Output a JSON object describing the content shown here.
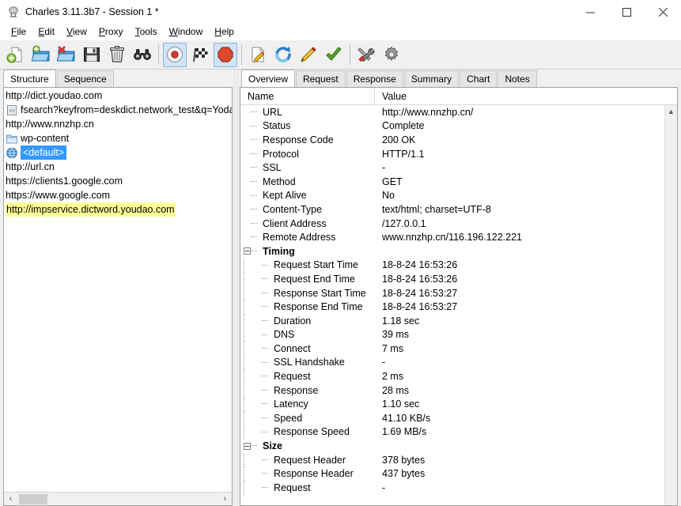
{
  "window": {
    "title": "Charles 3.11.3b7 - Session 1 *",
    "app_icon": "charles-glass-icon",
    "controls": [
      {
        "name": "minimize",
        "glyph": "—"
      },
      {
        "name": "maximize",
        "glyph": "☐"
      },
      {
        "name": "close",
        "glyph": "✕"
      }
    ]
  },
  "menubar": {
    "items": [
      {
        "mnemonic": "F",
        "rest": "ile"
      },
      {
        "mnemonic": "E",
        "rest": "dit"
      },
      {
        "mnemonic": "V",
        "rest": "iew"
      },
      {
        "mnemonic": "P",
        "rest": "roxy"
      },
      {
        "mnemonic": "T",
        "rest": "ools"
      },
      {
        "mnemonic": "W",
        "rest": "indow"
      },
      {
        "mnemonic": "H",
        "rest": "elp"
      }
    ]
  },
  "toolbar": {
    "buttons": [
      {
        "name": "new-session-icon",
        "active": false
      },
      {
        "name": "open-session-icon",
        "active": false
      },
      {
        "name": "close-session-icon",
        "active": false
      },
      {
        "name": "save-session-icon",
        "active": false
      },
      {
        "name": "clear-session-icon",
        "active": false
      },
      {
        "name": "find-icon",
        "active": false
      },
      {
        "name": "record-icon",
        "active": true
      },
      {
        "name": "throttle-icon",
        "active": false
      },
      {
        "name": "breakpoints-icon",
        "active": true
      },
      {
        "name": "compose-icon",
        "active": false
      },
      {
        "name": "repeat-icon",
        "active": false
      },
      {
        "name": "edit-icon",
        "active": false
      },
      {
        "name": "validate-icon",
        "active": false
      },
      {
        "name": "tools-icon",
        "active": false
      },
      {
        "name": "settings-icon",
        "active": false
      }
    ]
  },
  "left_panel": {
    "tabs": [
      {
        "label": "Structure",
        "active": true
      },
      {
        "label": "Sequence",
        "active": false
      }
    ],
    "tree": [
      {
        "label": "http://dict.youdao.com",
        "icon": "none",
        "indent": 0,
        "state": "normal"
      },
      {
        "label": "fsearch?keyfrom=deskdict.network_test&q=Yodao'",
        "icon": "file-icon",
        "indent": 1,
        "state": "normal"
      },
      {
        "label": "http://www.nnzhp.cn",
        "icon": "none",
        "indent": 0,
        "state": "normal"
      },
      {
        "label": "wp-content",
        "icon": "folder-icon",
        "indent": 1,
        "state": "normal"
      },
      {
        "label": "<default>",
        "icon": "globe-icon",
        "indent": 1,
        "state": "selected"
      },
      {
        "label": "http://url.cn",
        "icon": "none",
        "indent": 0,
        "state": "normal"
      },
      {
        "label": "https://clients1.google.com",
        "icon": "none",
        "indent": 0,
        "state": "normal"
      },
      {
        "label": "https://www.google.com",
        "icon": "none",
        "indent": 0,
        "state": "normal"
      },
      {
        "label": "http://impservice.dictword.youdao.com",
        "icon": "none",
        "indent": 0,
        "state": "highlighted"
      }
    ],
    "scrollbar": {
      "left_arrow": "‹",
      "right_arrow": "›"
    }
  },
  "right_panel": {
    "tabs": [
      {
        "label": "Overview",
        "active": true
      },
      {
        "label": "Request",
        "active": false
      },
      {
        "label": "Response",
        "active": false
      },
      {
        "label": "Summary",
        "active": false
      },
      {
        "label": "Chart",
        "active": false
      },
      {
        "label": "Notes",
        "active": false
      }
    ],
    "columns": {
      "name": "Name",
      "value": "Value"
    },
    "scrollbar": {
      "up_arrow": "▲"
    },
    "rows": [
      {
        "name": "URL",
        "value": "http://www.nnzhp.cn/",
        "type": "leaf"
      },
      {
        "name": "Status",
        "value": "Complete",
        "type": "leaf"
      },
      {
        "name": "Response Code",
        "value": "200 OK",
        "type": "leaf"
      },
      {
        "name": "Protocol",
        "value": "HTTP/1.1",
        "type": "leaf"
      },
      {
        "name": "SSL",
        "value": "-",
        "type": "leaf"
      },
      {
        "name": "Method",
        "value": "GET",
        "type": "leaf"
      },
      {
        "name": "Kept Alive",
        "value": "No",
        "type": "leaf"
      },
      {
        "name": "Content-Type",
        "value": "text/html; charset=UTF-8",
        "type": "leaf"
      },
      {
        "name": "Client Address",
        "value": "/127.0.0.1",
        "type": "leaf"
      },
      {
        "name": "Remote Address",
        "value": "www.nnzhp.cn/116.196.122.221",
        "type": "leaf"
      },
      {
        "name": "Timing",
        "value": "",
        "type": "group"
      },
      {
        "name": "Request Start Time",
        "value": "18-8-24 16:53:26",
        "type": "child"
      },
      {
        "name": "Request End Time",
        "value": "18-8-24 16:53:26",
        "type": "child"
      },
      {
        "name": "Response Start Time",
        "value": "18-8-24 16:53:27",
        "type": "child"
      },
      {
        "name": "Response End Time",
        "value": "18-8-24 16:53:27",
        "type": "child"
      },
      {
        "name": "Duration",
        "value": "1.18 sec",
        "type": "child"
      },
      {
        "name": "DNS",
        "value": "39 ms",
        "type": "child"
      },
      {
        "name": "Connect",
        "value": "7 ms",
        "type": "child"
      },
      {
        "name": "SSL Handshake",
        "value": "-",
        "type": "child"
      },
      {
        "name": "Request",
        "value": "2 ms",
        "type": "child"
      },
      {
        "name": "Response",
        "value": "28 ms",
        "type": "child"
      },
      {
        "name": "Latency",
        "value": "1.10 sec",
        "type": "child"
      },
      {
        "name": "Speed",
        "value": "41.10 KB/s",
        "type": "child"
      },
      {
        "name": "Response Speed",
        "value": "1.69 MB/s",
        "type": "child"
      },
      {
        "name": "Size",
        "value": "",
        "type": "group"
      },
      {
        "name": "Request Header",
        "value": "378 bytes",
        "type": "child"
      },
      {
        "name": "Response Header",
        "value": "437 bytes",
        "type": "child"
      },
      {
        "name": "Request",
        "value": "-",
        "type": "child"
      }
    ]
  },
  "colors": {
    "selection_blue": "#3399ff",
    "highlight_yellow": "#ffff99",
    "toolbar_active": "#cfe4f7",
    "panel_bg": "#f0f0f0"
  }
}
